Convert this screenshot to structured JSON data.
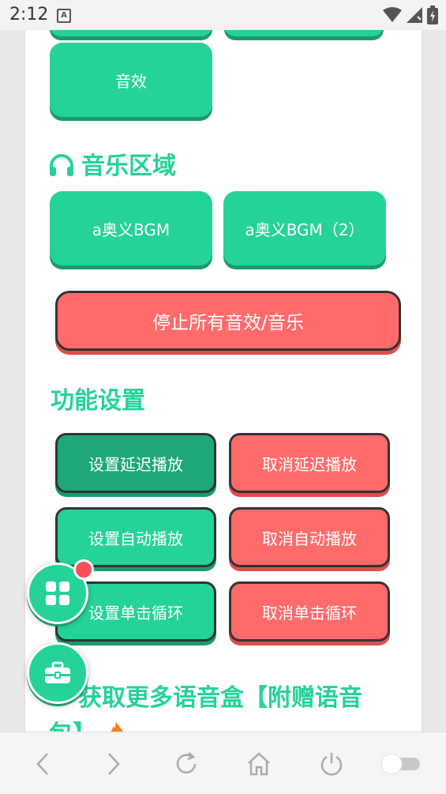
{
  "status_bar": {
    "time": "2:12",
    "notification_icon": "A"
  },
  "buttons_top": {
    "partial_left": "",
    "partial_right": "",
    "sound_effect": "音效"
  },
  "music_section": {
    "title": "音乐区域",
    "icon": "headphones-icon",
    "items": [
      "a奥义BGM",
      "a奥义BGM（2）"
    ]
  },
  "stop_button": "停止所有音效/音乐",
  "function_section": {
    "title": "功能设置",
    "set_delay": "设置延迟播放",
    "cancel_delay": "取消延迟播放",
    "set_auto": "设置自动播放",
    "cancel_auto": "取消自动播放",
    "set_loop": "设置单击循环",
    "cancel_loop": "取消单击循环"
  },
  "promo": {
    "line1": "获取更多语音盒【附赠语音",
    "line2": "包】"
  },
  "colors": {
    "green": "#25d29a",
    "red": "#ff6b6b",
    "dark_green": "#1ea87a"
  }
}
